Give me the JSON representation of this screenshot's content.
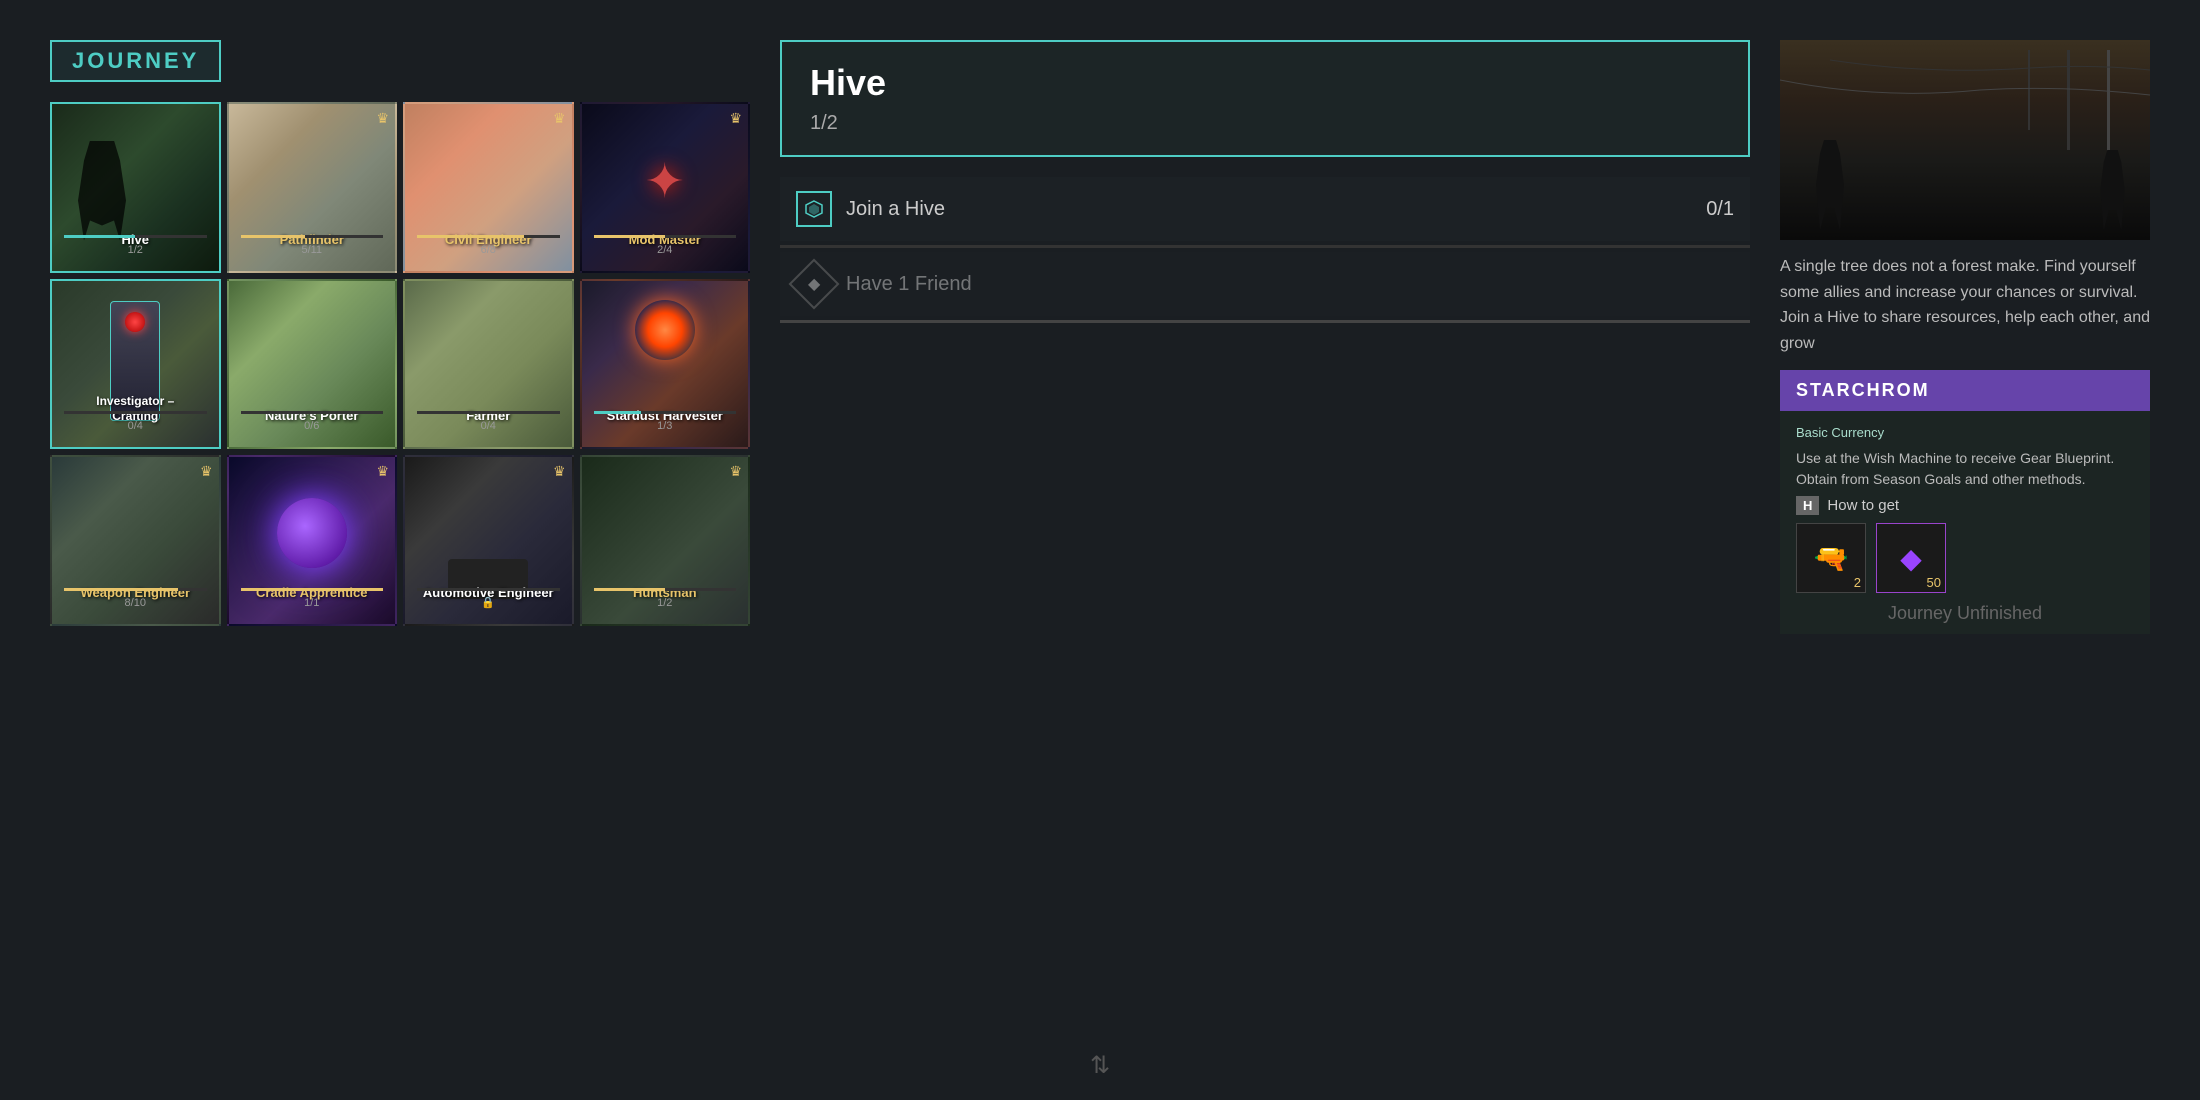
{
  "journey": {
    "title": "JOURNEY"
  },
  "cards": [
    {
      "id": "hive",
      "label": "Hive",
      "labelColor": "white",
      "progress": "1/2",
      "progressFill": 50,
      "bg": "bg-hive",
      "hasCrown": false,
      "active": true,
      "row": 0
    },
    {
      "id": "pathfinder",
      "label": "Pathfinder",
      "labelColor": "gold",
      "progress": "5/11",
      "progressFill": 45,
      "bg": "bg-pathfinder",
      "hasCrown": true,
      "active": false,
      "row": 0
    },
    {
      "id": "civil-engineer",
      "label": "Civil Engineer",
      "labelColor": "gold",
      "progress": "6/8",
      "progressFill": 75,
      "bg": "bg-civil",
      "hasCrown": true,
      "active": false,
      "row": 0
    },
    {
      "id": "mod-master",
      "label": "Mod Master",
      "labelColor": "gold",
      "progress": "2/4",
      "progressFill": 50,
      "bg": "bg-modmaster",
      "hasCrown": true,
      "active": false,
      "row": 0
    },
    {
      "id": "investigator",
      "label": "Investigator – Crafting",
      "labelColor": "white",
      "progress": "0/4",
      "progressFill": 0,
      "bg": "bg-investigator",
      "hasCrown": false,
      "active": true,
      "row": 1
    },
    {
      "id": "natures-porter",
      "label": "Nature's Porter",
      "labelColor": "white",
      "progress": "0/6",
      "progressFill": 0,
      "bg": "bg-natures",
      "hasCrown": false,
      "active": false,
      "row": 1
    },
    {
      "id": "farmer",
      "label": "Farmer",
      "labelColor": "white",
      "progress": "0/4",
      "progressFill": 0,
      "bg": "bg-farmer",
      "hasCrown": false,
      "active": false,
      "row": 1
    },
    {
      "id": "stardust",
      "label": "Stardust Harvester",
      "labelColor": "white",
      "progress": "1/3",
      "progressFill": 33,
      "bg": "bg-stardust",
      "hasCrown": false,
      "active": false,
      "row": 1
    },
    {
      "id": "weapon-engineer",
      "label": "Weapon Engineer",
      "labelColor": "gold",
      "progress": "8/10",
      "progressFill": 80,
      "bg": "bg-weapon",
      "hasCrown": true,
      "active": false,
      "row": 2
    },
    {
      "id": "cradle-apprentice",
      "label": "Cradle Apprentice",
      "labelColor": "gold",
      "progress": "1/1",
      "progressFill": 100,
      "bg": "bg-cradle",
      "hasCrown": true,
      "active": false,
      "row": 2
    },
    {
      "id": "automotive",
      "label": "Automotive Engineer",
      "labelColor": "white",
      "progress": "",
      "progressFill": 0,
      "bg": "bg-automotive",
      "hasCrown": true,
      "active": false,
      "row": 2
    },
    {
      "id": "huntsman",
      "label": "Huntsman",
      "labelColor": "gold",
      "progress": "1/2",
      "progressFill": 50,
      "bg": "bg-huntsman",
      "hasCrown": true,
      "active": false,
      "row": 2
    }
  ],
  "selected": {
    "title": "Hive",
    "subtitle": "1/2",
    "quests": [
      {
        "label": "Join a Hive",
        "progress": "0/1",
        "progressFill": 0,
        "locked": false,
        "icon": "hive"
      },
      {
        "label": "Have 1 Friend",
        "progress": "",
        "progressFill": 0,
        "locked": true,
        "icon": "diamond"
      }
    ]
  },
  "detail": {
    "description": "A single tree does not a forest make. Find yourself some allies and increase your chances or survival. Join a Hive to share resources, help each other, and grow",
    "currency_name": "STARCHROM",
    "currency_label": "Basic Currency",
    "currency_desc": "Use at the Wish Machine to receive Gear Blueprint. Obtain from Season Goals and other methods.",
    "how_to_get_key": "H",
    "how_to_get_label": "How to get",
    "reward1_count": "2",
    "reward2_count": "50",
    "journey_status": "Journey Unfinished"
  }
}
